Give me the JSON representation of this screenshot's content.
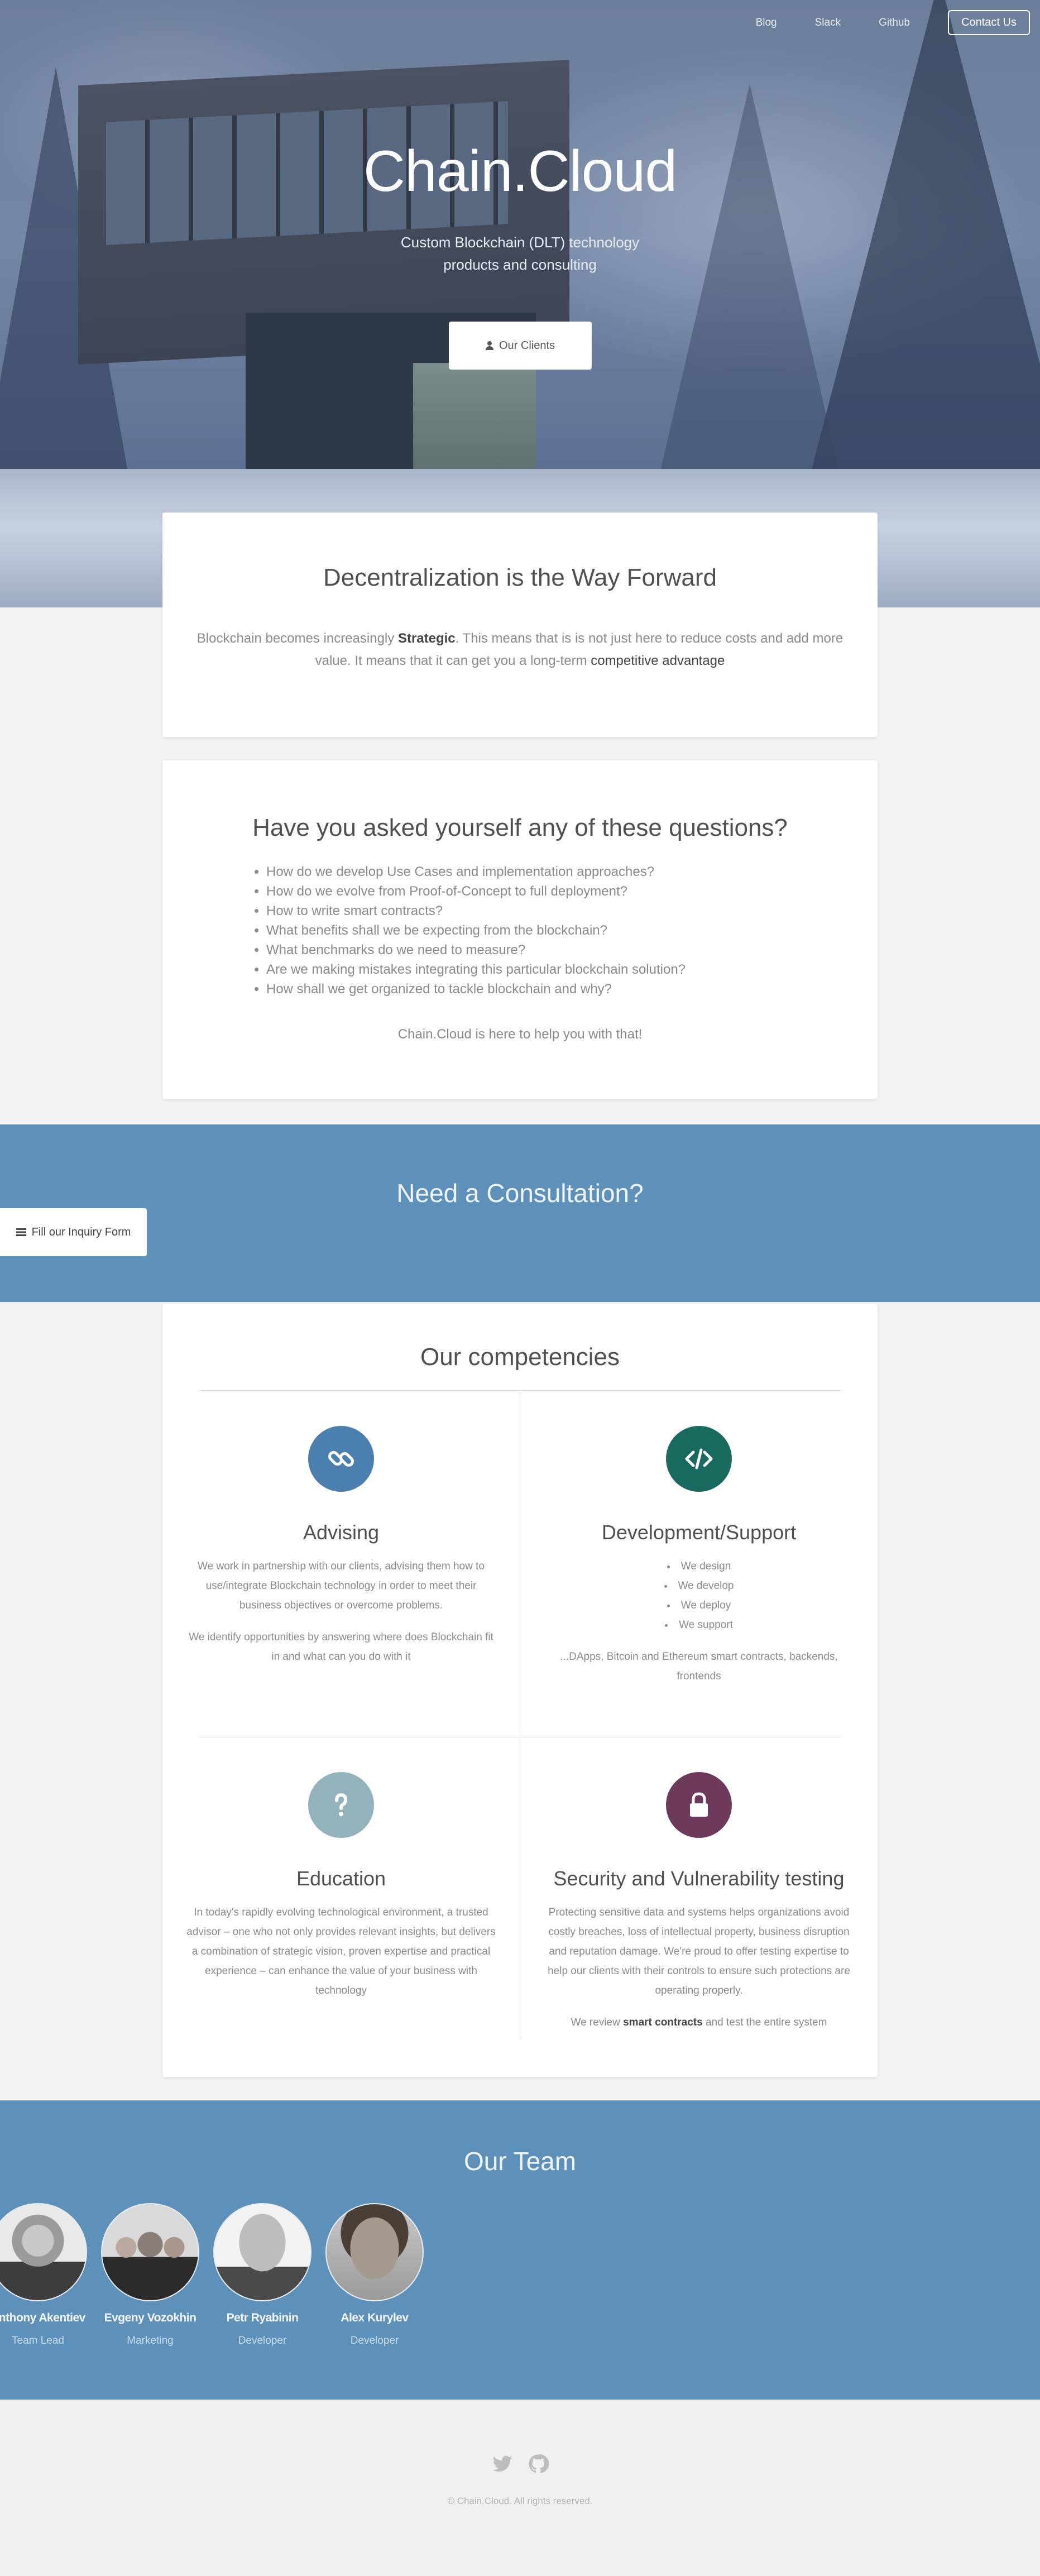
{
  "nav": {
    "links": [
      "Blog",
      "Slack",
      "Github"
    ],
    "contact_label": "Contact Us"
  },
  "hero": {
    "title": "Chain.Cloud",
    "subtitle_line1": "Custom Blockchain (DLT) technology",
    "subtitle_line2": "products and consulting",
    "clients_button": "Our Clients",
    "clients_icon": "user-icon"
  },
  "intro": {
    "title": "Decentralization is the Way Forward",
    "text_before": "Blockchain becomes increasingly ",
    "text_strong": "Strategic",
    "text_middle": ". This means that is is not just here to reduce costs and add more value. It means that it can get you a long-term ",
    "text_end": "competitive advantage"
  },
  "questions": {
    "title": "Have you asked yourself any of these questions?",
    "items": [
      "How do we develop Use Cases and implementation approaches?",
      "How do we evolve from Proof-of-Concept to full deployment?",
      "How to write smart contracts?",
      "What benefits shall we be expecting from the blockchain?",
      "What benchmarks do we need to measure?",
      "Are we making mistakes integrating this particular blockchain solution?",
      "How shall we get organized to tackle blockchain and why?"
    ],
    "footer": "Chain.Cloud is here to help you with that!"
  },
  "consult": {
    "title": "Need a Consultation?",
    "button": "Fill our Inquiry Form",
    "button_icon": "list-icon"
  },
  "competencies": {
    "title": "Our competencies",
    "advising": {
      "icon": "link-icon",
      "color": "#4a7fae",
      "title": "Advising",
      "p1": "We work in partnership with our clients, advising them how to use/integrate Blockchain technology in order to meet their business objectives or overcome problems.",
      "p2": "We identify opportunities by answering where does Blockchain fit in and what can you do with it"
    },
    "development": {
      "icon": "code-icon",
      "color": "#18695e",
      "title": "Development/Support",
      "items": [
        "We design",
        "We develop",
        "We deploy",
        "We support"
      ],
      "p1": "...DApps, Bitcoin and Ethereum smart contracts, backends, frontends"
    },
    "education": {
      "icon": "question-icon",
      "color": "#93b2bb",
      "title": "Education",
      "p1": "In today's rapidly evolving technological environment, a trusted advisor – one who not only provides relevant insights, but delivers a combination of strategic vision, proven expertise and practical experience – can enhance the value of your business with technology"
    },
    "security": {
      "icon": "lock-icon",
      "color": "#6e3a5b",
      "title": "Security and Vulnerability testing",
      "p1": "Protecting sensitive data and systems helps organizations avoid costly breaches, loss of intellectual property, business disruption and reputation damage. We're proud to offer testing expertise to help our clients with their controls to ensure such protections are operating properly.",
      "p2_before": "We review ",
      "p2_strong": "smart contracts",
      "p2_after": " and test the entire system"
    }
  },
  "team": {
    "title": "Our Team",
    "members": [
      {
        "name": "Anthony Akentiev",
        "role": "Team Lead"
      },
      {
        "name": "Evgeny Vozokhin",
        "role": "Marketing"
      },
      {
        "name": "Petr Ryabinin",
        "role": "Developer"
      },
      {
        "name": "Alex Kurylev",
        "role": "Developer"
      }
    ]
  },
  "footer": {
    "social_icons": [
      "twitter-icon",
      "github-icon"
    ],
    "copyright": "© Chain.Cloud. All rights reserved."
  }
}
